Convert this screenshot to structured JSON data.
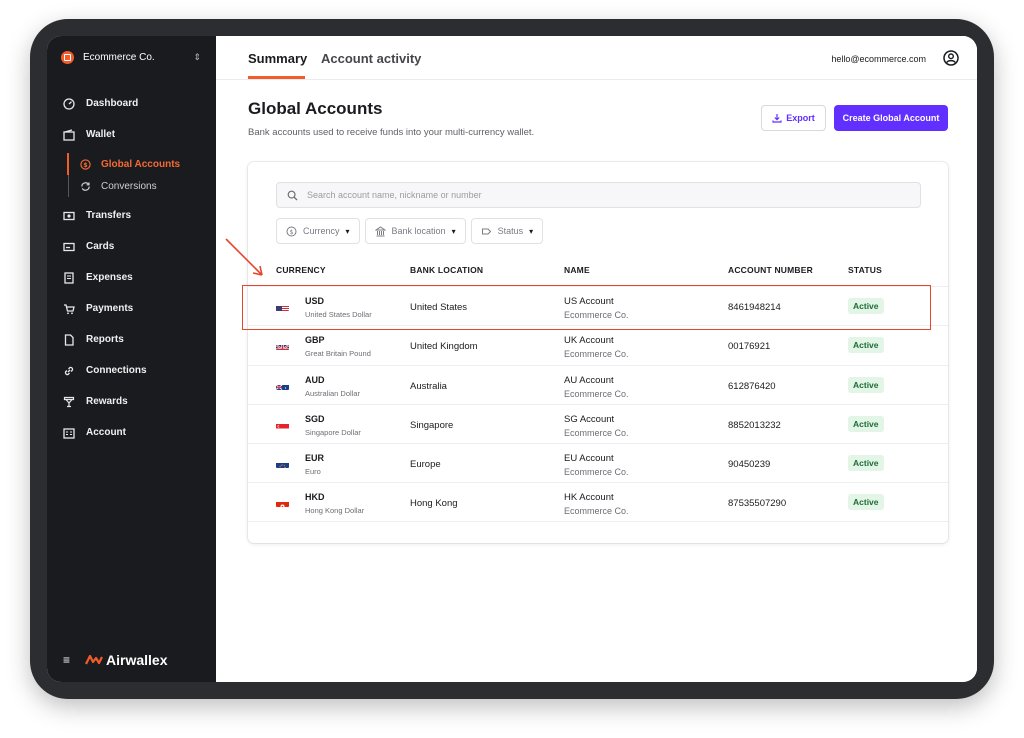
{
  "company": {
    "name": "Ecommerce Co."
  },
  "sidebar": {
    "items": [
      {
        "label": "Dashboard",
        "icon": "dashboard-icon"
      },
      {
        "label": "Wallet",
        "icon": "wallet-icon"
      },
      {
        "label": "Transfers",
        "icon": "transfers-icon"
      },
      {
        "label": "Cards",
        "icon": "cards-icon"
      },
      {
        "label": "Expenses",
        "icon": "expenses-icon"
      },
      {
        "label": "Payments",
        "icon": "payments-icon"
      },
      {
        "label": "Reports",
        "icon": "reports-icon"
      },
      {
        "label": "Connections",
        "icon": "connections-icon"
      },
      {
        "label": "Rewards",
        "icon": "rewards-icon"
      },
      {
        "label": "Account",
        "icon": "account-icon"
      }
    ],
    "wallet_sub": [
      {
        "label": "Global Accounts",
        "active": true
      },
      {
        "label": "Conversions",
        "active": false
      }
    ],
    "brand": "Airwallex"
  },
  "header": {
    "tabs": [
      {
        "label": "Summary",
        "active": true
      },
      {
        "label": "Account activity",
        "active": false
      }
    ],
    "user_email": "hello@ecommerce.com"
  },
  "page": {
    "title": "Global Accounts",
    "subtitle": "Bank accounts used to receive funds into your multi-currency wallet.",
    "export_label": "Export",
    "create_label": "Create Global Account"
  },
  "search": {
    "placeholder": "Search account name, nickname or number",
    "value": ""
  },
  "filters": [
    {
      "label": "Currency"
    },
    {
      "label": "Bank location"
    },
    {
      "label": "Status"
    }
  ],
  "table": {
    "columns": [
      "CURRENCY",
      "BANK LOCATION",
      "NAME",
      "ACCOUNT NUMBER",
      "STATUS"
    ],
    "rows": [
      {
        "code": "USD",
        "currency_name": "United States Dollar",
        "location": "United States",
        "account_name": "US Account",
        "org": "Ecommerce Co.",
        "account_number": "8461948214",
        "status": "Active",
        "flag": "us"
      },
      {
        "code": "GBP",
        "currency_name": "Great Britain Pound",
        "location": "United Kingdom",
        "account_name": "UK Account",
        "org": "Ecommerce Co.",
        "account_number": "00176921",
        "status": "Active",
        "flag": "gb"
      },
      {
        "code": "AUD",
        "currency_name": "Australian Dollar",
        "location": "Australia",
        "account_name": "AU Account",
        "org": "Ecommerce Co.",
        "account_number": "612876420",
        "status": "Active",
        "flag": "au"
      },
      {
        "code": "SGD",
        "currency_name": "Singapore Dollar",
        "location": "Singapore",
        "account_name": "SG Account",
        "org": "Ecommerce Co.",
        "account_number": "8852013232",
        "status": "Active",
        "flag": "sg"
      },
      {
        "code": "EUR",
        "currency_name": "Euro",
        "location": "Europe",
        "account_name": "EU Account",
        "org": "Ecommerce Co.",
        "account_number": "90450239",
        "status": "Active",
        "flag": "eu"
      },
      {
        "code": "HKD",
        "currency_name": "Hong Kong Dollar",
        "location": "Hong Kong",
        "account_name": "HK Account",
        "org": "Ecommerce Co.",
        "account_number": "87535507290",
        "status": "Active",
        "flag": "hk"
      }
    ]
  },
  "colors": {
    "accent": "#612fff",
    "brand_orange": "#f25c2a",
    "sidebar_bg": "#1a1b1e",
    "status_bg": "#e2f5e6",
    "status_text": "#1e6b34",
    "highlight": "#e8452b"
  }
}
